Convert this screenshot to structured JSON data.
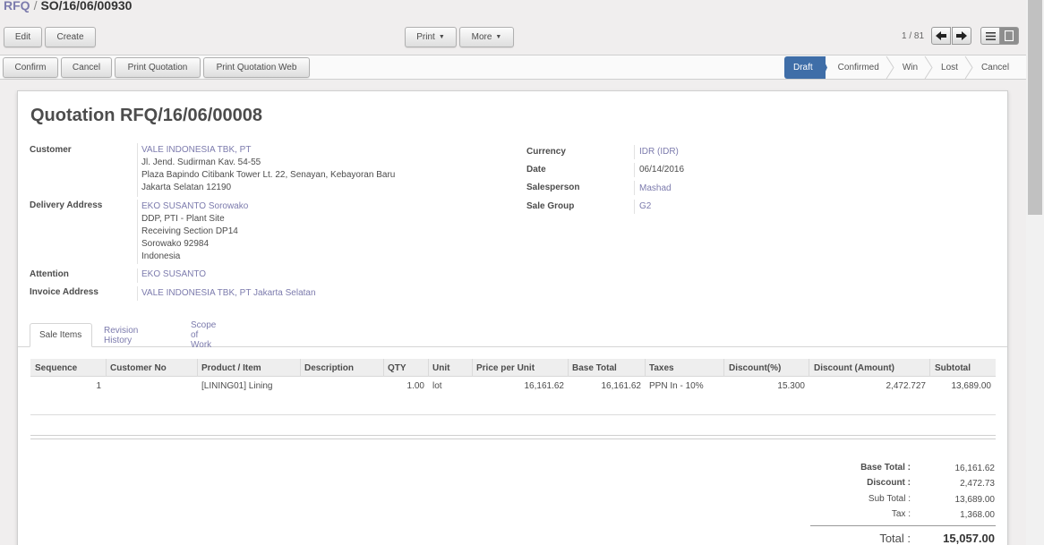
{
  "breadcrumb": {
    "parent": "RFQ",
    "separator": "/",
    "current": "SO/16/06/00930"
  },
  "toolbar": {
    "edit": "Edit",
    "create": "Create",
    "print": "Print",
    "more": "More",
    "pager": "1 / 81"
  },
  "actions": {
    "confirm": "Confirm",
    "cancel": "Cancel",
    "print_quotation": "Print Quotation",
    "print_quotation_web": "Print Quotation Web"
  },
  "stages": [
    "Draft",
    "Confirmed",
    "Win",
    "Lost",
    "Cancel"
  ],
  "active_stage": "Draft",
  "form": {
    "title": "Quotation RFQ/16/06/00008",
    "customer_label": "Customer",
    "customer_name": "VALE INDONESIA TBK, PT",
    "customer_addr1": "Jl. Jend. Sudirman Kav. 54-55",
    "customer_addr2": "Plaza Bapindo Citibank Tower Lt. 22, Senayan, Kebayoran Baru",
    "customer_addr3": "Jakarta Selatan 12190",
    "delivery_label": "Delivery Address",
    "delivery_name": "EKO SUSANTO Sorowako",
    "delivery_addr1": "DDP, PTI - Plant Site",
    "delivery_addr2": "Receiving Section DP14",
    "delivery_addr3": "Sorowako 92984",
    "delivery_addr4": "Indonesia",
    "attention_label": "Attention",
    "attention_value": "EKO SUSANTO",
    "invoice_label": "Invoice Address",
    "invoice_value": "VALE INDONESIA TBK, PT Jakarta Selatan",
    "currency_label": "Currency",
    "currency_value": "IDR (IDR)",
    "date_label": "Date",
    "date_value": "06/14/2016",
    "salesperson_label": "Salesperson",
    "salesperson_value": "Mashad",
    "salegroup_label": "Sale Group",
    "salegroup_value": "G2"
  },
  "tabs": [
    "Sale Items",
    "Revision History",
    "Scope of Work"
  ],
  "table": {
    "headers": [
      "Sequence",
      "Customer No",
      "Product / Item",
      "Description",
      "QTY",
      "Unit",
      "Price per Unit",
      "Base Total",
      "Taxes",
      "Discount(%)",
      "Discount (Amount)",
      "Subtotal"
    ],
    "rows": [
      [
        "1",
        "",
        "[LINING01] Lining",
        "",
        "1.00",
        "lot",
        "16,161.62",
        "16,161.62",
        "PPN In - 10%",
        "15.300",
        "2,472.727",
        "13,689.00"
      ]
    ]
  },
  "totals": {
    "base_total_label": "Base Total :",
    "base_total": "16,161.62",
    "discount_label": "Discount :",
    "discount": "2,472.73",
    "subtotal_label": "Sub Total :",
    "subtotal": "13,689.00",
    "tax_label": "Tax :",
    "tax": "1,368.00",
    "total_label": "Total :",
    "total": "15,057.00"
  },
  "colors": {
    "link": "#7c7bad",
    "active_stage": "#3f6ea8"
  }
}
